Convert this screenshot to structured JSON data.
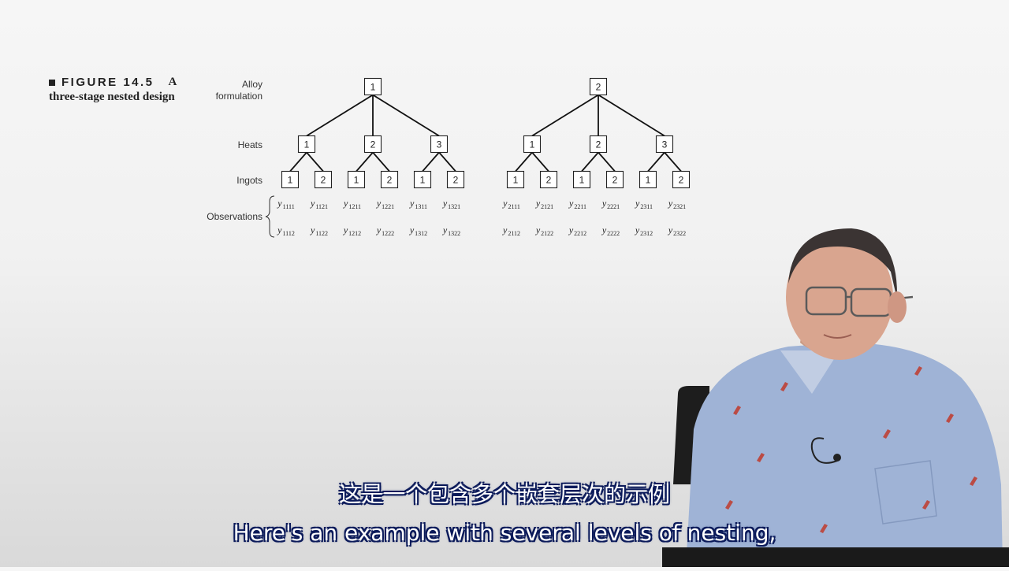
{
  "figure": {
    "number_label": "FIGURE 14.5",
    "title_letter": "A",
    "subtitle": "three-stage nested design"
  },
  "row_labels": {
    "alloy_line1": "Alloy",
    "alloy_line2": "formulation",
    "heats": "Heats",
    "ingots": "Ingots",
    "observations": "Observations"
  },
  "tree": {
    "alloys": [
      {
        "label": "1",
        "heats": [
          {
            "label": "1",
            "ingots": [
              {
                "label": "1",
                "obs": [
                  [
                    "y",
                    "1111"
                  ],
                  [
                    "y",
                    "1112"
                  ]
                ]
              },
              {
                "label": "2",
                "obs": [
                  [
                    "y",
                    "1121"
                  ],
                  [
                    "y",
                    "1122"
                  ]
                ]
              }
            ]
          },
          {
            "label": "2",
            "ingots": [
              {
                "label": "1",
                "obs": [
                  [
                    "y",
                    "1211"
                  ],
                  [
                    "y",
                    "1212"
                  ]
                ]
              },
              {
                "label": "2",
                "obs": [
                  [
                    "y",
                    "1221"
                  ],
                  [
                    "y",
                    "1222"
                  ]
                ]
              }
            ]
          },
          {
            "label": "3",
            "ingots": [
              {
                "label": "1",
                "obs": [
                  [
                    "y",
                    "1311"
                  ],
                  [
                    "y",
                    "1312"
                  ]
                ]
              },
              {
                "label": "2",
                "obs": [
                  [
                    "y",
                    "1321"
                  ],
                  [
                    "y",
                    "1322"
                  ]
                ]
              }
            ]
          }
        ]
      },
      {
        "label": "2",
        "heats": [
          {
            "label": "1",
            "ingots": [
              {
                "label": "1",
                "obs": [
                  [
                    "y",
                    "2111"
                  ],
                  [
                    "y",
                    "2112"
                  ]
                ]
              },
              {
                "label": "2",
                "obs": [
                  [
                    "y",
                    "2121"
                  ],
                  [
                    "y",
                    "2122"
                  ]
                ]
              }
            ]
          },
          {
            "label": "2",
            "ingots": [
              {
                "label": "1",
                "obs": [
                  [
                    "y",
                    "2211"
                  ],
                  [
                    "y",
                    "2212"
                  ]
                ]
              },
              {
                "label": "2",
                "obs": [
                  [
                    "y",
                    "2221"
                  ],
                  [
                    "y",
                    "2222"
                  ]
                ]
              }
            ]
          },
          {
            "label": "3",
            "ingots": [
              {
                "label": "1",
                "obs": [
                  [
                    "y",
                    "2311"
                  ],
                  [
                    "y",
                    "2312"
                  ]
                ]
              },
              {
                "label": "2",
                "obs": [
                  [
                    "y",
                    "2321"
                  ],
                  [
                    "y",
                    "2322"
                  ]
                ]
              }
            ]
          }
        ]
      }
    ]
  },
  "subtitles": {
    "chinese": "这是一个包含多个嵌套层次的示例",
    "english": "Here's an example with several levels of nesting,"
  }
}
